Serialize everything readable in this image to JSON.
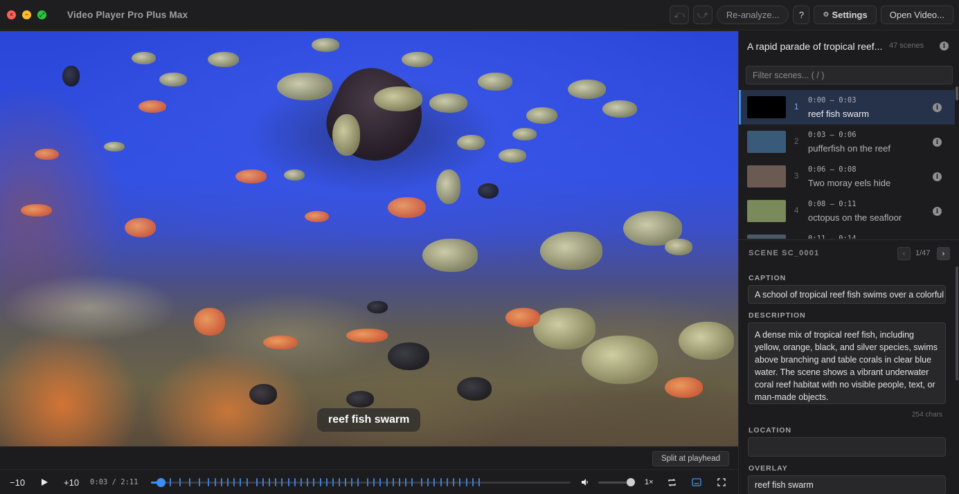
{
  "window": {
    "title": "Video Player Pro Plus Max",
    "buttons": {
      "undo": "⤺",
      "redo": "⤻",
      "reanalyze": "Re-analyze...",
      "help": "?",
      "settings": "Settings",
      "open_video": "Open Video..."
    }
  },
  "video": {
    "subtitle": "reef fish swarm",
    "split_button": "Split at playhead"
  },
  "controls": {
    "back10": "−10",
    "forward10": "+10",
    "time": "0:03 / 2:11",
    "progress": 0.023,
    "volume": 0.9,
    "speed": "1×",
    "scene_markers": [
      0.023,
      0.045,
      0.068,
      0.091,
      0.114,
      0.136,
      0.152,
      0.167,
      0.182,
      0.197,
      0.212,
      0.227,
      0.25,
      0.265,
      0.28,
      0.295,
      0.311,
      0.326,
      0.341,
      0.356,
      0.371,
      0.386,
      0.402,
      0.417,
      0.432,
      0.447,
      0.462,
      0.477,
      0.492,
      0.515,
      0.53,
      0.545,
      0.561,
      0.576,
      0.591,
      0.606,
      0.621,
      0.644,
      0.659,
      0.674,
      0.689,
      0.705,
      0.72,
      0.735,
      0.75,
      0.765,
      0.78
    ]
  },
  "panel": {
    "title": "A rapid parade of tropical reef...",
    "count": "47 scenes",
    "filter_placeholder": "Filter scenes... ( / )",
    "scenes": [
      {
        "num": "1",
        "time": "0:00 — 0:03",
        "label": "reef fish swarm",
        "thumb": "#000000"
      },
      {
        "num": "2",
        "time": "0:03 — 0:06",
        "label": "pufferfish on the reef",
        "thumb": "#3a5a7a"
      },
      {
        "num": "3",
        "time": "0:06 — 0:08",
        "label": "Two moray eels hide",
        "thumb": "#6a5a52"
      },
      {
        "num": "4",
        "time": "0:08 — 0:11",
        "label": "octopus on the seafloor",
        "thumb": "#7a8a5a"
      },
      {
        "num": "5",
        "time": "0:11 — 0:14",
        "label": "",
        "thumb": "#4a5a6a"
      }
    ],
    "scene_id": "SCENE SC_0001",
    "page": "1/47",
    "caption_label": "CAPTION",
    "caption": "A school of tropical reef fish swims over a colorful coral reef.",
    "description_label": "DESCRIPTION",
    "description": "A dense mix of tropical reef fish, including yellow, orange, black, and silver species, swims above branching and table corals in clear blue water. The scene shows a vibrant underwater coral reef habitat with no visible people, text, or man-made objects.",
    "char_count": "254 chars",
    "location_label": "LOCATION",
    "location": "",
    "overlay_label": "OVERLAY",
    "overlay": "reef fish swarm"
  }
}
